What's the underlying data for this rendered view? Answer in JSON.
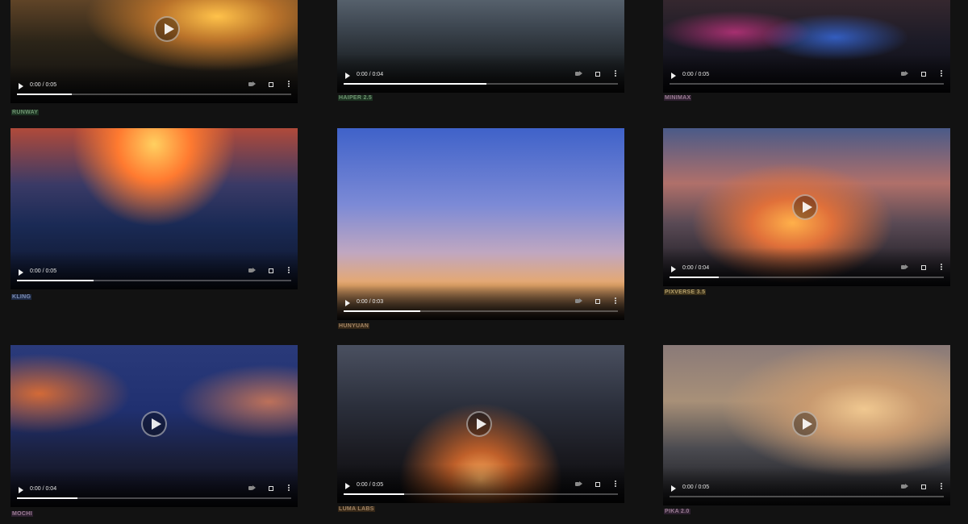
{
  "videos": [
    {
      "name": "RUNWAY",
      "time": "0:00 / 0:05",
      "progress": 0.2,
      "label_color": "#6f9471",
      "label_bg": "#1d3322",
      "scene": "radial-gradient(ellipse at 72% 22%, #ffc24a 0%, #b9722a 20%, rgba(60,40,20,0) 45%), linear-gradient(180deg, #6a4a2a 0%, #2b2418 45%, #0d0d0f 100%)"
    },
    {
      "name": "HAIPER 2.5",
      "time": "0:00 / 0:04",
      "progress": 0.52,
      "label_color": "#6f9471",
      "label_bg": "#1d3322",
      "scene": "linear-gradient(180deg, #5d6874 0%, #3d4650 35%, #1f2428 70%, #111 100%)"
    },
    {
      "name": "MINIMAX",
      "time": "0:00 / 0:05",
      "progress": 0.0,
      "label_color": "#9b7d93",
      "label_bg": "#2e2030",
      "scene": "radial-gradient(ellipse at 25% 40%, rgba(255,60,160,0.6) 0%, rgba(0,0,0,0) 25%), radial-gradient(ellipse at 60% 45%, rgba(60,120,255,0.7) 0%, rgba(0,0,0,0) 30%), linear-gradient(180deg, #3a2a30 0%, #1b1a26 50%, #0a0a10 100%)"
    },
    {
      "name": "KLING",
      "time": "0:00 / 0:05",
      "progress": 0.28,
      "label_color": "#7f8fb4",
      "label_bg": "#1e2a44",
      "scene": "radial-gradient(ellipse at 50% 10%, #ffd060 0%, #ff7a30 18%, rgba(120,40,60,0) 40%), linear-gradient(180deg, #b04a3a 0%, #3a3a66 35%, #1a2a55 60%, #0e1428 100%)"
    },
    {
      "name": "HUNYUAN",
      "time": "0:00 / 0:03",
      "progress": 0.28,
      "label_color": "#a28565",
      "label_bg": "#352717",
      "scene": "linear-gradient(180deg, #3f62c9 0%, #7c8ad6 40%, #c0a7c0 65%, #e8a86a 82%, #221a18 100%)"
    },
    {
      "name": "PIXVERSE 3.5",
      "time": "0:00 / 0:04",
      "progress": 0.18,
      "label_color": "#b39f6a",
      "label_bg": "#3a301a",
      "scene": "radial-gradient(ellipse at 45% 60%, #ffb04a 0%, #e0703a 18%, rgba(90,60,80,0) 45%), linear-gradient(180deg, #4a5a88 0%, #b0706a 35%, #5a4a55 60%, #101218 100%)"
    },
    {
      "name": "MOCHI",
      "time": "0:00 / 0:04",
      "progress": 0.22,
      "label_color": "#9b7d93",
      "label_bg": "#2e2030",
      "scene": "radial-gradient(ellipse at 10% 30%, rgba(255,120,40,0.8) 0%, rgba(0,0,0,0) 25%), radial-gradient(ellipse at 90% 35%, rgba(255,140,80,0.7) 0%, rgba(0,0,0,0) 25%), linear-gradient(180deg, #2a3a7a 0%, #203070 40%, #1a1f3a 70%, #0c0c14 100%)"
    },
    {
      "name": "LUMA LABS",
      "time": "0:00 / 0:05",
      "progress": 0.22,
      "label_color": "#a28565",
      "label_bg": "#352717",
      "scene": "radial-gradient(ellipse at 50% 85%, #ffb060 0%, #c0602a 15%, rgba(40,30,30,0) 40%), linear-gradient(180deg, #4a5060 0%, #2a2e3a 40%, #1a1a20 70%, #0a0a0c 100%)"
    },
    {
      "name": "PIKA 2.0",
      "time": "0:00 / 0:05",
      "progress": 0.0,
      "label_color": "#9b7d93",
      "label_bg": "#2e2030",
      "scene": "radial-gradient(ellipse at 70% 40%, #f0c890 0%, #c89a70 20%, rgba(80,70,70,0) 50%), linear-gradient(180deg, #8a7a78 0%, #a89078 35%, #4a4a50 65%, #151518 100%)"
    }
  ]
}
